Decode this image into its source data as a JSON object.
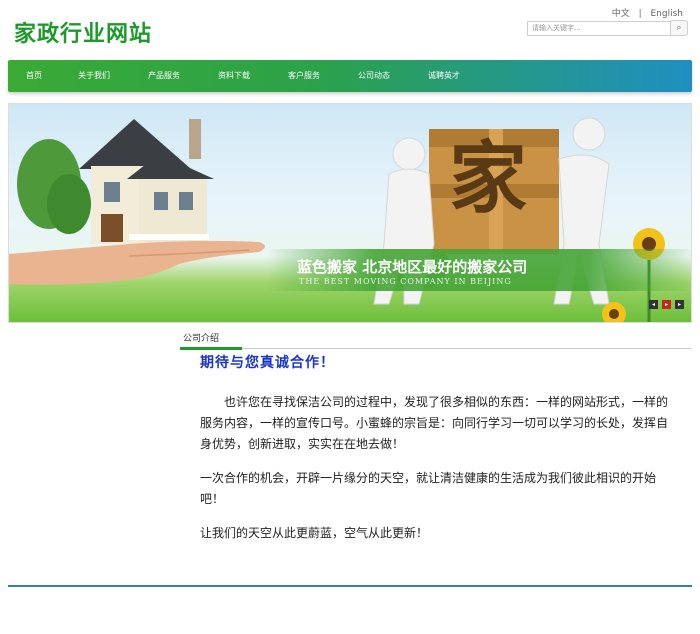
{
  "header": {
    "site_title": "家政行业网站",
    "lang_cn": "中文",
    "lang_sep": "|",
    "lang_en": "English",
    "search_placeholder": "请输入关键字..."
  },
  "nav": {
    "items": [
      "首页",
      "关于我们",
      "产品服务",
      "资料下载",
      "客户服务",
      "公司动态",
      "诚聘英才"
    ]
  },
  "banner": {
    "title": "蓝色搬家    北京地区最好的搬家公司",
    "subtitle": "THE BEST MOVING COMPANY IN BEIJING",
    "box_char": "家"
  },
  "section": {
    "tab_label": "公司介绍",
    "article_title": "期待与您真诚合作！",
    "paragraphs": [
      "　　也许您在寻找保洁公司的过程中，发现了很多相似的东西：一样的网站形式，一样的服务内容，一样的宣传口号。小蜜蜂的宗旨是：向同行学习一切可以学习的长处，发挥自身优势，创新进取，实实在在地去做！",
      "一次合作的机会，开辟一片缘分的天空，就让清洁健康的生活成为我们彼此相识的开始吧！",
      "让我们的天空从此更蔚蓝，空气从此更新！"
    ]
  },
  "colors": {
    "brand_green": "#1d9a2a",
    "nav_blue": "#1f8fc2",
    "title_blue": "#1a36c6"
  }
}
